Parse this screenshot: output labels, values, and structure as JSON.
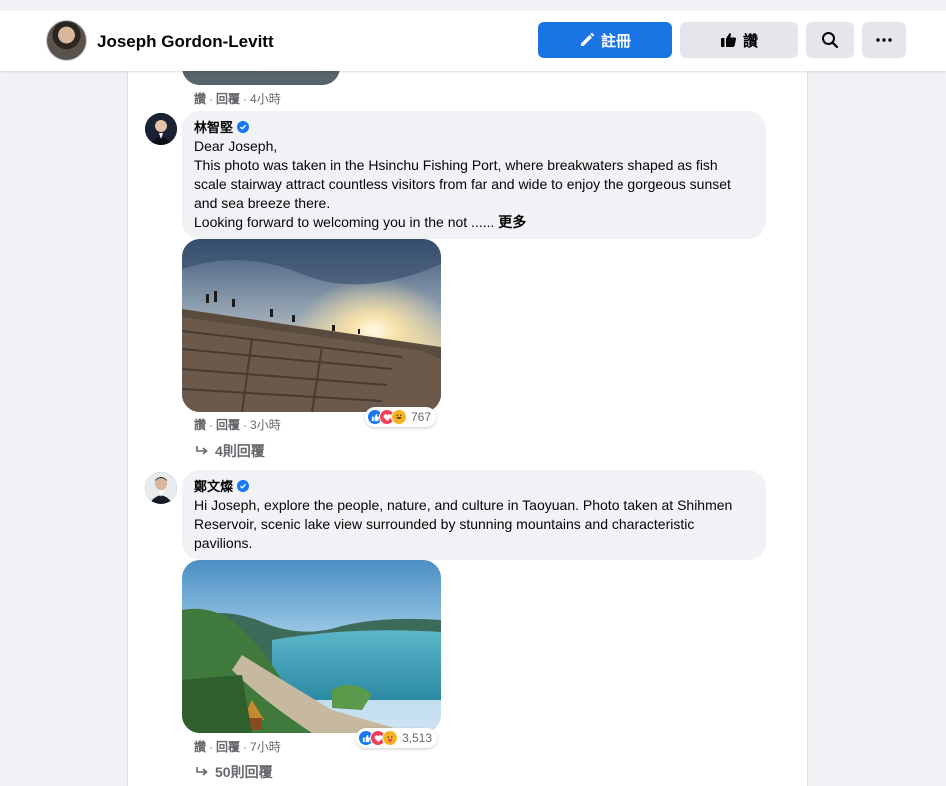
{
  "header": {
    "profile_name": "Joseph Gordon-Levitt",
    "edit_button": "註冊",
    "like_button": "讚",
    "search_icon": "search-icon",
    "more_icon": "more-horizontal-icon",
    "accent_color": "#1b74e4"
  },
  "previous_comment": {
    "action_like": "讚",
    "action_reply": "回覆",
    "timestamp": "4小時"
  },
  "comments": [
    {
      "author": "林智堅",
      "verified": true,
      "lines": [
        "Dear Joseph,",
        "This photo was taken in the Hsinchu Fishing Port, where breakwaters shaped as fish scale stairway attract countless visitors from far and wide to enjoy the gorgeous sunset and sea breeze there.",
        "Looking forward to welcoming you in the not ......"
      ],
      "see_more": "更多",
      "photo_alt": "sunset over stepped breakwater",
      "action_like": "讚",
      "action_reply": "回覆",
      "timestamp": "3小時",
      "reactions": [
        "like",
        "love",
        "haha"
      ],
      "reaction_count": "767",
      "replies_label": "4則回覆"
    },
    {
      "author": "鄭文燦",
      "verified": true,
      "lines": [
        "Hi Joseph, explore the people, nature, and culture in Taoyuan. Photo taken at Shihmen Reservoir, scenic lake view surrounded by stunning mountains and characteristic pavilions."
      ],
      "photo_alt": "lake view with mountains and pavilions",
      "action_like": "讚",
      "action_reply": "回覆",
      "timestamp": "7小時",
      "reactions": [
        "like",
        "love",
        "care"
      ],
      "reaction_count": "3,513",
      "replies_label": "50則回覆"
    }
  ]
}
